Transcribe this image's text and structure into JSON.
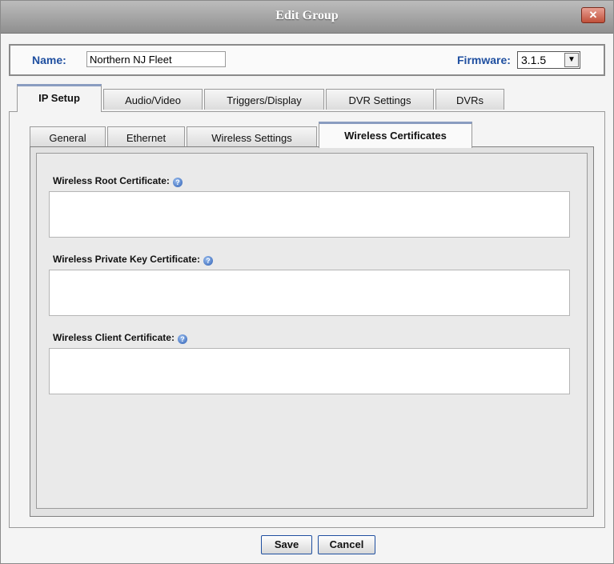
{
  "window": {
    "title": "Edit Group",
    "close_glyph": "✕"
  },
  "name_bar": {
    "name_label": "Name:",
    "name_value": "Northern NJ Fleet",
    "firmware_label": "Firmware:",
    "firmware_value": "3.1.5"
  },
  "main_tabs": [
    {
      "label": "IP Setup",
      "active": true
    },
    {
      "label": "Audio/Video",
      "active": false
    },
    {
      "label": "Triggers/Display",
      "active": false
    },
    {
      "label": "DVR Settings",
      "active": false
    },
    {
      "label": "DVRs",
      "active": false
    }
  ],
  "sub_tabs": [
    {
      "label": "General",
      "active": false
    },
    {
      "label": "Ethernet",
      "active": false
    },
    {
      "label": "Wireless Settings",
      "active": false
    },
    {
      "label": "Wireless Certificates",
      "active": true
    }
  ],
  "fields": [
    {
      "label": "Wireless Root Certificate:",
      "value": ""
    },
    {
      "label": "Wireless Private Key Certificate:",
      "value": ""
    },
    {
      "label": "Wireless Client Certificate:",
      "value": ""
    }
  ],
  "buttons": {
    "save": "Save",
    "cancel": "Cancel"
  },
  "icons": {
    "help": "help-icon",
    "close": "close-icon",
    "dropdown": "chevron-down-icon"
  },
  "colors": {
    "label_blue": "#1f4fa0",
    "titlebar": "#9e9e9e",
    "close_red": "#c0503a"
  }
}
